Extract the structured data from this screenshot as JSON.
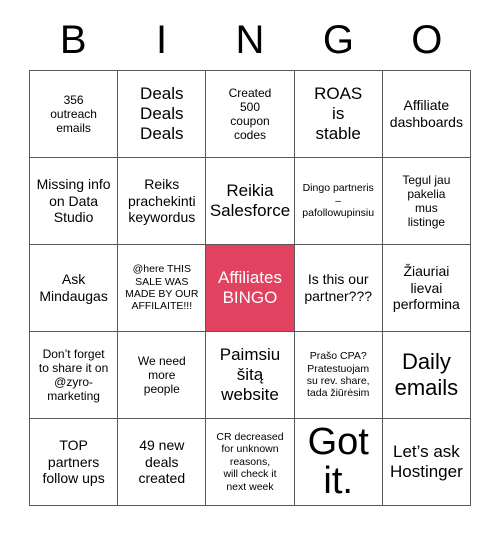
{
  "card": {
    "title": "Affiliates BINGO",
    "header_letters": [
      "B",
      "I",
      "N",
      "G",
      "O"
    ],
    "highlight_color": "#e0425f",
    "border_color": "#595959",
    "background_color": "#ffffff",
    "rows": [
      [
        {
          "text": "356\noutreach\nemails",
          "size": "sm",
          "highlight": false
        },
        {
          "text": "Deals\nDeals\nDeals",
          "size": "lg",
          "highlight": false
        },
        {
          "text": "Created\n500\ncoupon\ncodes",
          "size": "sm",
          "highlight": false
        },
        {
          "text": "ROAS\nis\nstable",
          "size": "lg",
          "highlight": false
        },
        {
          "text": "Affiliate\ndashboards",
          "size": "md",
          "highlight": false
        }
      ],
      [
        {
          "text": "Missing info\non Data\nStudio",
          "size": "md",
          "highlight": false
        },
        {
          "text": "Reiks\nprachekinti\nkeywordus",
          "size": "md",
          "highlight": false
        },
        {
          "text": "Reikia\nSalesforce",
          "size": "lg",
          "highlight": false
        },
        {
          "text": "Dingo partneris\n–\npafollowupinsiu",
          "size": "xs",
          "highlight": false
        },
        {
          "text": "Tegul jau\npakelia\nmus\nlistinge",
          "size": "sm",
          "highlight": false
        }
      ],
      [
        {
          "text": "Ask\nMindaugas",
          "size": "md",
          "highlight": false
        },
        {
          "text": "@here THIS\nSALE WAS\nMADE BY OUR\nAFFILAITE!!!",
          "size": "xs",
          "highlight": false
        },
        {
          "text": "Affiliates\nBINGO",
          "size": "lg",
          "highlight": true
        },
        {
          "text": "Is this our\npartner???",
          "size": "md",
          "highlight": false
        },
        {
          "text": "Žiauriai\nlievai\nperformina",
          "size": "md",
          "highlight": false
        }
      ],
      [
        {
          "text": "Don’t forget\nto share it on\n@zyro-\nmarketing",
          "size": "sm",
          "highlight": false
        },
        {
          "text": "We need\nmore\npeople",
          "size": "sm",
          "highlight": false
        },
        {
          "text": "Paimsiu\nšitą\nwebsite",
          "size": "lg",
          "highlight": false
        },
        {
          "text": "Prašo CPA?\nPratestuojam\nsu rev. share,\ntada žiūrėsim",
          "size": "xs",
          "highlight": false
        },
        {
          "text": "Daily\nemails",
          "size": "xxl",
          "highlight": false
        }
      ],
      [
        {
          "text": "TOP\npartners\nfollow ups",
          "size": "md",
          "highlight": false
        },
        {
          "text": "49 new\ndeals\ncreated",
          "size": "md",
          "highlight": false
        },
        {
          "text": "CR decreased\nfor unknown\nreasons,\nwill check it\nnext week",
          "size": "xs",
          "highlight": false
        },
        {
          "text": "Got\nit.",
          "size": "huge",
          "highlight": false
        },
        {
          "text": "Let’s ask\nHostinger",
          "size": "lg",
          "highlight": false
        }
      ]
    ]
  }
}
